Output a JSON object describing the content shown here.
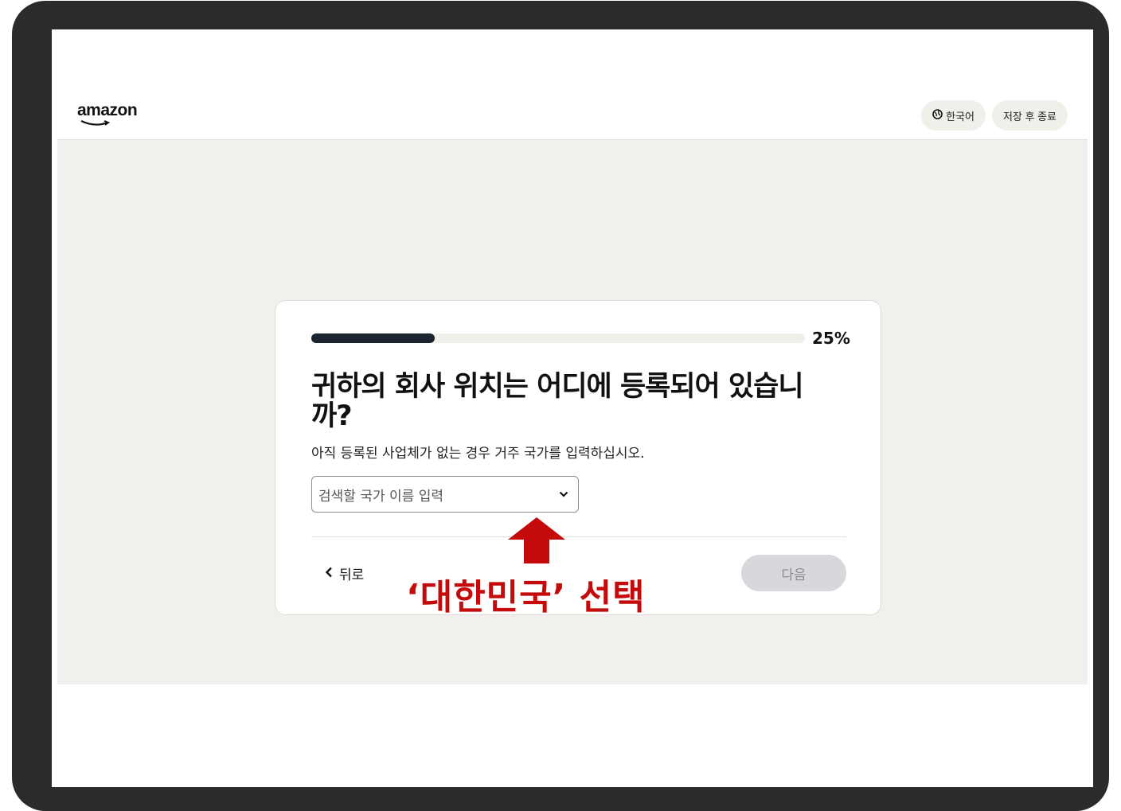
{
  "header": {
    "logo_text": "amazon",
    "language_button": "한국어",
    "save_exit_button": "저장 후 종료"
  },
  "card": {
    "progress_fraction": 0.25,
    "progress_label": "25%",
    "question": "귀하의 회사 위치는 어디에 등록되어 있습니까?",
    "subtitle": "아직 등록된 사업체가 없는 경우 거주 국가를 입력하십시오.",
    "country_select": {
      "placeholder": "검색할 국가 이름 입력",
      "selected_value": ""
    },
    "back_label": "뒤로",
    "next_label": "다음"
  },
  "annotation": {
    "text": "‘대한민국’ 선택",
    "color": "#c40a0a"
  },
  "colors": {
    "progress_fill": "#1b2431",
    "content_background": "#f1f0ec",
    "next_disabled": "#d7d8dc"
  },
  "icons": {
    "language": "globe-icon",
    "dropdown": "chevron-down-icon",
    "back": "chevron-left-icon",
    "annotation": "up-arrow-icon"
  }
}
